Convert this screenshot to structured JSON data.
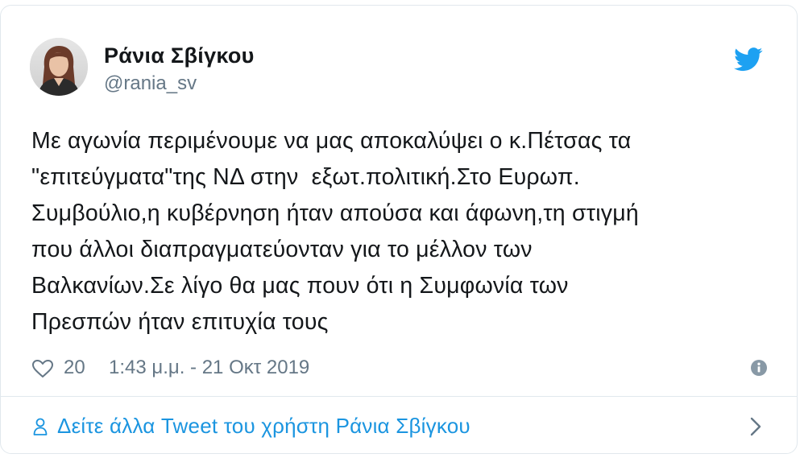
{
  "tweet": {
    "author": {
      "display_name": "Ράνια Σβίγκου",
      "handle": "@rania_sv",
      "avatar_icon": "profile-photo"
    },
    "text": "Με αγωνία περιμένουμε να μας αποκαλύψει ο κ.Πέτσας τα\n\"επιτεύγματα\"της ΝΔ στην  εξωτ.πολιτική.Στο Ευρωπ.\nΣυμβούλιο,η κυβέρνηση ήταν απούσα και άφωνη,τη στιγμή\nπου άλλοι διαπραγματεύονταν για το μέλλον των\nΒαλκανίων.Σε λίγο θα μας πουν ότι η Συμφωνία των\nΠρεσπών ήταν επιτυχία τους",
    "likes": "20",
    "timestamp": "1:43 μ.μ. - 21 Οκτ 2019",
    "more_tweets_label": "Δείτε άλλα Tweet του χρήστη Ράνια Σβίγκου"
  },
  "icons": {
    "brand": "twitter-bird-icon",
    "like": "heart-icon",
    "info": "info-icon",
    "person": "person-icon",
    "chevron": "chevron-right-icon"
  },
  "colors": {
    "brand_blue": "#1da1f2",
    "link_blue": "#1b95e0",
    "text": "#14171a",
    "muted": "#657786",
    "border": "#e1e8ed"
  }
}
